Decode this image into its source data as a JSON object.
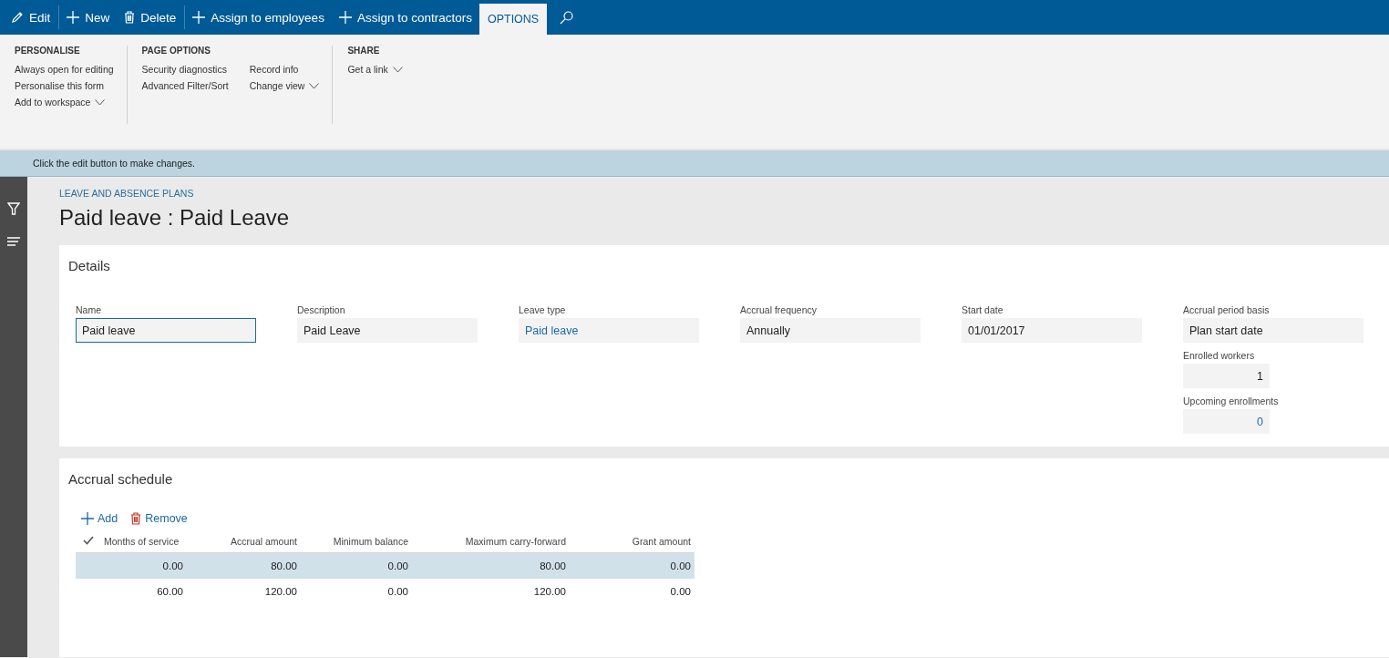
{
  "toolbar": {
    "items": [
      {
        "label": "Edit",
        "kind": "pencil",
        "separator_after": true
      },
      {
        "label": "New",
        "kind": "plus",
        "separator_after": false
      },
      {
        "label": "Delete",
        "kind": "trash",
        "separator_after": true
      },
      {
        "label": "Assign to employees",
        "kind": "plus",
        "separator_after": false
      },
      {
        "label": "Assign to contractors",
        "kind": "plus",
        "separator_after": false
      }
    ],
    "tabs": [
      {
        "label": "OPTIONS",
        "selected": true
      }
    ]
  },
  "ribbon": {
    "groups": [
      {
        "title": "PERSONALISE",
        "columns": [
          [
            {
              "label": "Always open for editing",
              "dropdown": false
            },
            {
              "label": "Personalise this form",
              "dropdown": false
            },
            {
              "label": "Add to workspace",
              "dropdown": true
            }
          ]
        ]
      },
      {
        "title": "PAGE OPTIONS",
        "columns": [
          [
            {
              "label": "Security diagnostics",
              "dropdown": false
            },
            {
              "label": "Advanced Filter/Sort",
              "dropdown": false
            }
          ],
          [
            {
              "label": "Record info",
              "dropdown": false
            },
            {
              "label": "Change view",
              "dropdown": true
            }
          ]
        ]
      },
      {
        "title": "SHARE",
        "columns": [
          [
            {
              "label": "Get a link",
              "dropdown": true
            }
          ]
        ]
      }
    ]
  },
  "message": "Click the edit button to make changes.",
  "breadcrumb": "LEAVE AND ABSENCE PLANS",
  "title": "Paid leave : Paid Leave",
  "details": {
    "heading": "Details",
    "columns": [
      [
        {
          "label": "Name",
          "value": "Paid leave",
          "kind": "text",
          "focused": true,
          "link": false
        }
      ],
      [
        {
          "label": "Description",
          "value": "Paid Leave",
          "kind": "text",
          "focused": false,
          "link": false
        }
      ],
      [
        {
          "label": "Leave type",
          "value": "Paid leave",
          "kind": "text",
          "focused": false,
          "link": true
        }
      ],
      [
        {
          "label": "Accrual frequency",
          "value": "Annually",
          "kind": "text",
          "focused": false,
          "link": false
        }
      ],
      [
        {
          "label": "Start date",
          "value": "01/01/2017",
          "kind": "text",
          "focused": false,
          "link": false
        }
      ],
      [
        {
          "label": "Accrual period basis",
          "value": "Plan start date",
          "kind": "text",
          "focused": false,
          "link": false
        },
        {
          "label": "Enrolled workers",
          "value": "1",
          "kind": "number",
          "focused": false,
          "link": false
        },
        {
          "label": "Upcoming enrollments",
          "value": "0",
          "kind": "number",
          "focused": false,
          "link": true
        }
      ]
    ]
  },
  "accrual": {
    "heading": "Accrual schedule",
    "actions": [
      {
        "label": "Add",
        "kind": "plus"
      },
      {
        "label": "Remove",
        "kind": "trash"
      }
    ],
    "columns": [
      "Months of service",
      "Accrual amount",
      "Minimum balance",
      "Maximum carry-forward",
      "Grant amount"
    ],
    "rows": [
      {
        "cells": [
          "0.00",
          "80.00",
          "0.00",
          "80.00",
          "0.00"
        ],
        "selected": true
      },
      {
        "cells": [
          "60.00",
          "120.00",
          "0.00",
          "120.00",
          "0.00"
        ],
        "selected": false
      }
    ]
  }
}
